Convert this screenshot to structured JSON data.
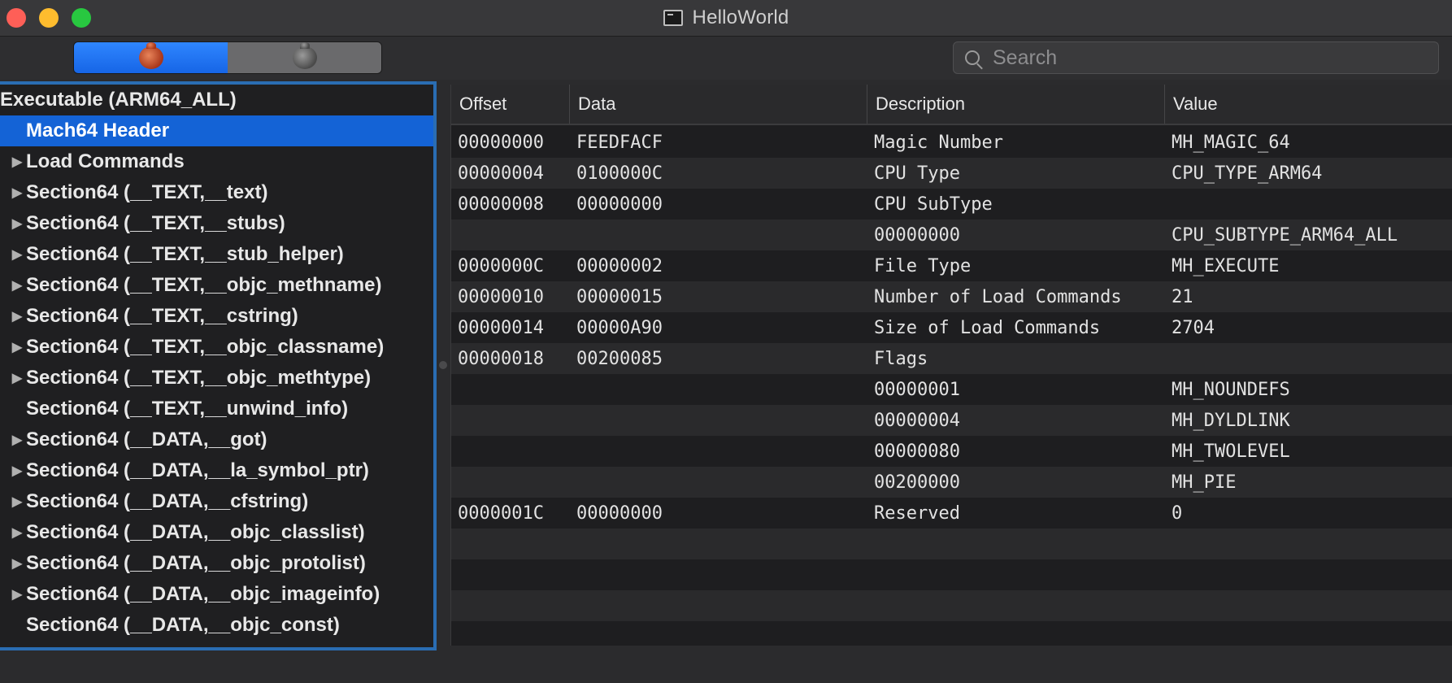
{
  "window": {
    "title": "HelloWorld"
  },
  "toolbar": {
    "segments": [
      {
        "name": "bug-colored-icon",
        "active": true
      },
      {
        "name": "bug-gray-icon",
        "active": false
      }
    ],
    "search": {
      "placeholder": "Search",
      "value": ""
    }
  },
  "outline": {
    "root": "Executable  (ARM64_ALL)",
    "items": [
      {
        "label": "Mach64 Header",
        "expandable": false,
        "selected": true
      },
      {
        "label": "Load Commands",
        "expandable": true
      },
      {
        "label": "Section64 (__TEXT,__text)",
        "expandable": true
      },
      {
        "label": "Section64 (__TEXT,__stubs)",
        "expandable": true
      },
      {
        "label": "Section64 (__TEXT,__stub_helper)",
        "expandable": true
      },
      {
        "label": "Section64 (__TEXT,__objc_methname)",
        "expandable": true
      },
      {
        "label": "Section64 (__TEXT,__cstring)",
        "expandable": true
      },
      {
        "label": "Section64 (__TEXT,__objc_classname)",
        "expandable": true
      },
      {
        "label": "Section64 (__TEXT,__objc_methtype)",
        "expandable": true
      },
      {
        "label": "Section64 (__TEXT,__unwind_info)",
        "expandable": false
      },
      {
        "label": "Section64 (__DATA,__got)",
        "expandable": true
      },
      {
        "label": "Section64 (__DATA,__la_symbol_ptr)",
        "expandable": true
      },
      {
        "label": "Section64 (__DATA,__cfstring)",
        "expandable": true
      },
      {
        "label": "Section64 (__DATA,__objc_classlist)",
        "expandable": true
      },
      {
        "label": "Section64 (__DATA,__objc_protolist)",
        "expandable": true
      },
      {
        "label": "Section64 (__DATA,__objc_imageinfo)",
        "expandable": true
      },
      {
        "label": "Section64 (__DATA,__objc_const)",
        "expandable": false
      }
    ]
  },
  "table": {
    "headers": [
      "Offset",
      "Data",
      "Description",
      "Value"
    ],
    "rows": [
      [
        "00000000",
        "FEEDFACF",
        "Magic Number",
        "MH_MAGIC_64"
      ],
      [
        "00000004",
        "0100000C",
        "CPU Type",
        "CPU_TYPE_ARM64"
      ],
      [
        "00000008",
        "00000000",
        "CPU SubType",
        ""
      ],
      [
        "",
        "",
        "00000000",
        "CPU_SUBTYPE_ARM64_ALL"
      ],
      [
        "0000000C",
        "00000002",
        "File Type",
        "MH_EXECUTE"
      ],
      [
        "00000010",
        "00000015",
        "Number of Load Commands",
        "21"
      ],
      [
        "00000014",
        "00000A90",
        "Size of Load Commands",
        "2704"
      ],
      [
        "00000018",
        "00200085",
        "Flags",
        ""
      ],
      [
        "",
        "",
        "00000001",
        "MH_NOUNDEFS"
      ],
      [
        "",
        "",
        "00000004",
        "MH_DYLDLINK"
      ],
      [
        "",
        "",
        "00000080",
        "MH_TWOLEVEL"
      ],
      [
        "",
        "",
        "00200000",
        "MH_PIE"
      ],
      [
        "0000001C",
        "00000000",
        "Reserved",
        "0"
      ],
      [
        "",
        "",
        "",
        ""
      ],
      [
        "",
        "",
        "",
        ""
      ],
      [
        "",
        "",
        "",
        ""
      ],
      [
        "",
        "",
        "",
        ""
      ]
    ]
  }
}
